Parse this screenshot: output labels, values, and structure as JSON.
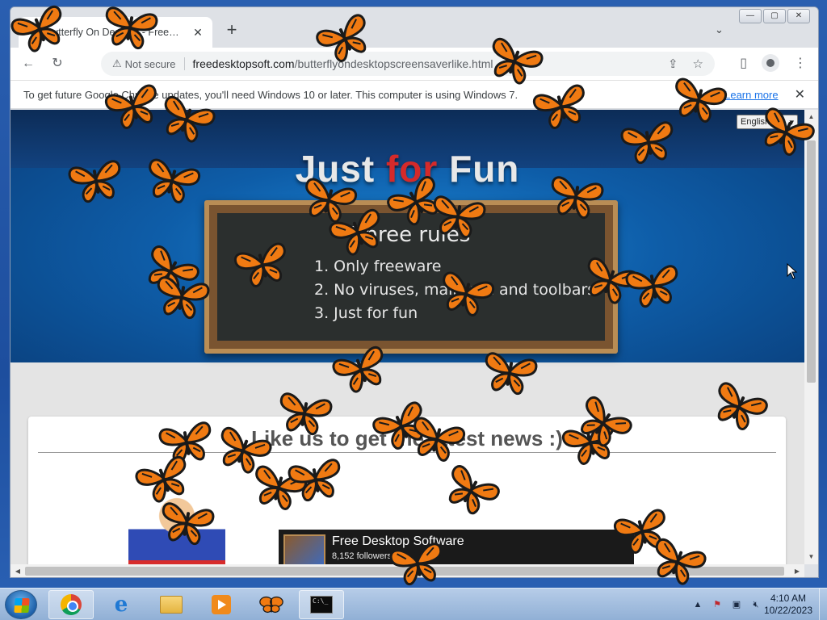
{
  "browser": {
    "tab": {
      "title": "Butterfly On Desktop - Freeware",
      "close_glyph": "✕"
    },
    "new_tab_glyph": "+",
    "tab_search_glyph": "⌄",
    "window_controls": {
      "minimize": "—",
      "maximize": "▢",
      "close": "✕"
    },
    "toolbar": {
      "security_label": "Not secure",
      "url_host": "freedesktopsoft.com",
      "url_path": "/butterflyondesktopscreensaverlike.html"
    },
    "infobar": {
      "message": "To get future Google Chrome updates, you'll need Windows 10 or later. This computer is using Windows 7.",
      "link": "Learn more",
      "close_glyph": "✕"
    }
  },
  "page": {
    "hero": {
      "title_part1": "Just ",
      "title_accent": "for",
      "title_part2": " Fun",
      "language_select": "English"
    },
    "board": {
      "heading": "Three rules",
      "rules": [
        "1. Only freeware",
        "2. No viruses, mallware and toolbars",
        "3. Just for fun"
      ]
    },
    "card": {
      "title": "Like us to get the latest news :)"
    },
    "fb_widget": {
      "name": "Free Desktop Software",
      "followers": "8,152 followers"
    }
  },
  "taskbar": {
    "clock_time": "4:10 AM",
    "clock_date": "10/22/2023",
    "cmd_text": "C:\\_"
  },
  "colors": {
    "butterfly_orange": "#f07a12",
    "butterfly_black": "#1a1a1a",
    "hero_blue": "#0e5da8",
    "title_accent_red": "#d42a2a"
  }
}
